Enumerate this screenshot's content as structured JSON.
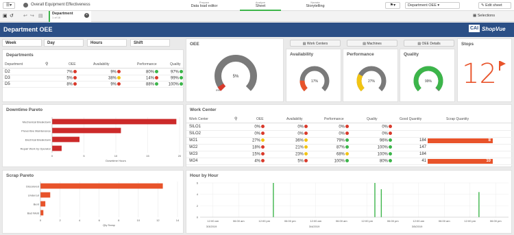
{
  "app": {
    "title": "Overall Equipment Effectiveness",
    "nav": [
      {
        "caption": "Prepare",
        "label": "Data load editor"
      },
      {
        "caption": "Analyze",
        "label": "Sheet"
      },
      {
        "caption": "Narrate",
        "label": "Storytelling"
      }
    ],
    "sheet_selector": "Department OEE",
    "edit_label": "Edit sheet",
    "selections_label": "Selections",
    "tab": {
      "label": "Department",
      "sub": "1 of 16"
    }
  },
  "banner": {
    "title": "Department OEE",
    "logo_box": "CAI",
    "logo_text": "ShopVue",
    "logo_color": "#2b4f86"
  },
  "filters": [
    "Week",
    "Day",
    "Hours",
    "Shift"
  ],
  "buttons": [
    "Work Centers",
    "Machines",
    "OEE Details"
  ],
  "colors": {
    "red": "#d93a2b",
    "orange": "#e8532a",
    "yellow": "#f2c413",
    "green": "#3cb54a",
    "gray": "#777777",
    "bar_red": "#cc2a2a"
  },
  "departments": {
    "title": "Departments",
    "headers": [
      "Department",
      "OEE",
      "Availability",
      "Performance",
      "Quality"
    ],
    "rows": [
      {
        "name": "D2",
        "oee": "7%",
        "avail": "9%",
        "perf": "80%",
        "qual": "97%",
        "c": [
          "red",
          "red",
          "green",
          "green"
        ]
      },
      {
        "name": "D3",
        "oee": "5%",
        "avail": "38%",
        "perf": "14%",
        "qual": "99%",
        "c": [
          "red",
          "yellow",
          "red",
          "green"
        ]
      },
      {
        "name": "D5",
        "oee": "8%",
        "avail": "9%",
        "perf": "88%",
        "qual": "100%",
        "c": [
          "red",
          "red",
          "green",
          "green"
        ]
      }
    ]
  },
  "gauges": {
    "oee": {
      "title": "OEE",
      "value": 5,
      "label": "5%",
      "min_label": "0%"
    },
    "availability": {
      "title": "Availability",
      "value": 17,
      "label": "17%"
    },
    "performance": {
      "title": "Performance",
      "value": 27,
      "label": "27%"
    },
    "quality": {
      "title": "Quality",
      "value": 99,
      "label": "99%"
    }
  },
  "stops": {
    "title": "Stops",
    "value": "12"
  },
  "work_center": {
    "title": "Work Center",
    "headers": [
      "Work Center",
      "OEE",
      "Availability",
      "Performance",
      "Quality",
      "Good Quantity",
      "Scrap Quantity"
    ],
    "rows": [
      {
        "name": "SILO1",
        "oee": "0%",
        "avail": "0%",
        "perf": "0%",
        "qual": "0%",
        "good": "",
        "scrap": "",
        "c": [
          "red",
          "red",
          "red",
          "red"
        ]
      },
      {
        "name": "SILO2",
        "oee": "0%",
        "avail": "0%",
        "perf": "0%",
        "qual": "0%",
        "good": "",
        "scrap": "",
        "c": [
          "red",
          "red",
          "red",
          "red"
        ]
      },
      {
        "name": "W21",
        "oee": "27%",
        "avail": "36%",
        "perf": "79%",
        "qual": "96%",
        "good": "184",
        "scrap": "8",
        "c": [
          "yellow",
          "yellow",
          "green",
          "green"
        ]
      },
      {
        "name": "W22",
        "oee": "18%",
        "avail": "21%",
        "perf": "87%",
        "qual": "100%",
        "good": "147",
        "scrap": "",
        "c": [
          "red",
          "yellow",
          "green",
          "green"
        ]
      },
      {
        "name": "W23",
        "oee": "15%",
        "avail": "23%",
        "perf": "68%",
        "qual": "100%",
        "good": "184",
        "scrap": "",
        "c": [
          "red",
          "yellow",
          "yellow",
          "green"
        ]
      },
      {
        "name": "W24",
        "oee": "4%",
        "avail": "5%",
        "perf": "100%",
        "qual": "80%",
        "good": "41",
        "scrap": "10",
        "c": [
          "red",
          "red",
          "green",
          "green"
        ]
      }
    ]
  },
  "chart_data": [
    {
      "type": "bar",
      "orientation": "horizontal",
      "title": "Downtime Pareto",
      "categories": [
        "Mechanical Breakdown",
        "Preventive Maintenance",
        "Electrical Breakdown",
        "Repair Work by Operator"
      ],
      "values": [
        19.5,
        10.8,
        4.3,
        1.5
      ],
      "xlabel": "Downtime Hours",
      "xlim": [
        0,
        20
      ],
      "xticks": [
        "0",
        "5",
        "10",
        "15",
        "20"
      ]
    },
    {
      "type": "bar",
      "orientation": "horizontal",
      "title": "Scrap Pareto",
      "categories": [
        "Discolored",
        "Undercut",
        "Bent",
        "Bad Weld"
      ],
      "values": [
        12.5,
        1.0,
        0.5,
        0.3
      ],
      "xlabel": "Qty Scrap",
      "xlim": [
        0,
        14
      ],
      "xticks": [
        "0",
        "2",
        "4",
        "6",
        "8",
        "10",
        "12",
        "14"
      ]
    },
    {
      "type": "bar",
      "title": "Hour by Hour",
      "yticks": [
        "6",
        "4",
        "2",
        "0"
      ],
      "ylim": [
        0,
        6
      ],
      "xticks": [
        "12:00 am",
        "06:00 am",
        "12:00 pm",
        "06:00 pm",
        "12:00 am",
        "06:00 am",
        "12:00 pm",
        "06:00 pm",
        "12:00 am",
        "06:00 am",
        "12:00 pm",
        "06:00 pm"
      ],
      "date_labels": [
        "3/3/2019",
        "3/4/2019",
        "3/5/2019"
      ],
      "spikes": [
        {
          "slot": 2.35,
          "value": 6.2
        },
        {
          "slot": 6.3,
          "value": 6.0
        },
        {
          "slot": 6.55,
          "value": 4.9
        },
        {
          "slot": 10.35,
          "value": 4.4
        }
      ]
    }
  ]
}
